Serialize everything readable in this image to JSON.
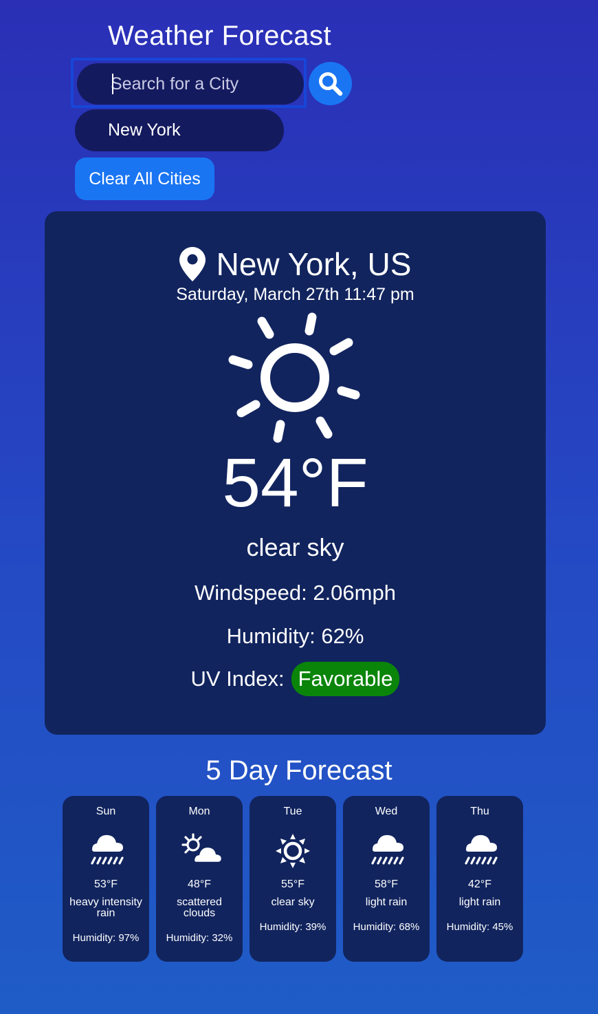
{
  "header": {
    "title": "Weather Forecast",
    "search_placeholder": "Search for a City",
    "search_value": "",
    "search_icon": "search-icon"
  },
  "history": {
    "cities": [
      "New York"
    ],
    "clear_label": "Clear All Cities"
  },
  "current": {
    "location": "New York, US",
    "location_icon": "map-pin-icon",
    "datetime": "Saturday, March 27th 11:47 pm",
    "weather_icon": "sun-icon",
    "temperature": "54°F",
    "description": "clear sky",
    "windspeed": "Windspeed: 2.06mph",
    "humidity": "Humidity: 62%",
    "uv_label": "UV Index:",
    "uv_value": "Favorable",
    "uv_color": "#0a850a"
  },
  "forecast": {
    "title": "5 Day Forecast",
    "days": [
      {
        "day": "Sun",
        "icon": "rain-cloud-icon",
        "temp": "53°F",
        "desc": "heavy intensity rain",
        "humidity": "Humidity: 97%"
      },
      {
        "day": "Mon",
        "icon": "sun-cloud-icon",
        "temp": "48°F",
        "desc": "scattered clouds",
        "humidity": "Humidity: 32%"
      },
      {
        "day": "Tue",
        "icon": "sun-icon",
        "temp": "55°F",
        "desc": "clear sky",
        "humidity": "Humidity: 39%"
      },
      {
        "day": "Wed",
        "icon": "rain-cloud-icon",
        "temp": "58°F",
        "desc": "light rain",
        "humidity": "Humidity: 68%"
      },
      {
        "day": "Thu",
        "icon": "rain-cloud-icon",
        "temp": "42°F",
        "desc": "light rain",
        "humidity": "Humidity: 45%"
      }
    ]
  },
  "colors": {
    "background_top": "#2a2fb6",
    "background_bottom": "#1f5cc6",
    "card": "#11245e",
    "input": "#141a5e",
    "accent": "#1a75f3"
  }
}
